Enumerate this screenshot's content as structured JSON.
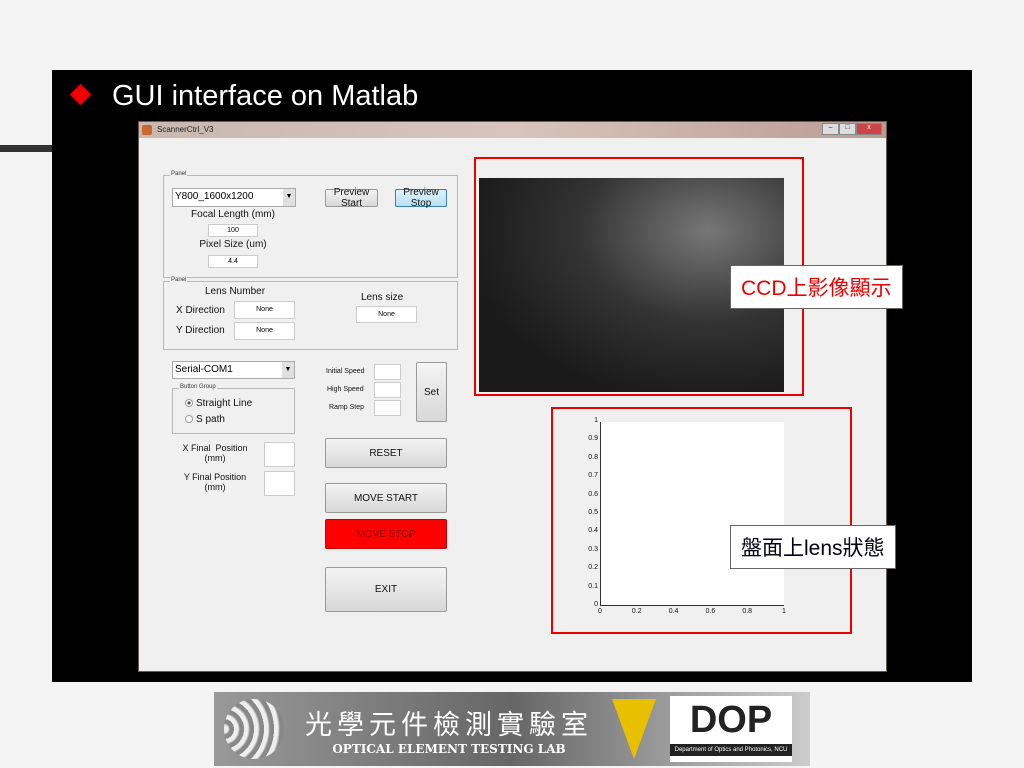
{
  "slide": {
    "title": "GUI interface on Matlab"
  },
  "window": {
    "title": "ScannerCtrl_V3",
    "min": "‒",
    "max": "□",
    "close": "x"
  },
  "panel1": {
    "title": "Panel",
    "camera_format": "Y800_1600x1200",
    "focal_label": "Focal Length (mm)",
    "focal_value": "100",
    "pixel_label": "Pixel Size (um)",
    "pixel_value": "4.4",
    "preview_start": "Preview Start",
    "preview_stop": "Preview Stop"
  },
  "panel2": {
    "title": "Panel",
    "lens_number": "Lens Number",
    "x_dir": "X Direction",
    "x_val": "None",
    "y_dir": "Y Direction",
    "y_val": "None",
    "lens_size": "Lens size",
    "lens_size_val": "None"
  },
  "serial": {
    "port": "Serial-COM1"
  },
  "button_group": {
    "title": "Button Group",
    "options": [
      "Straight Line",
      "S path"
    ],
    "selected": "Straight Line"
  },
  "positions": {
    "x_label": "X Final  Position\n(mm)",
    "y_label": "Y Final Position\n(mm)"
  },
  "speed": {
    "initial": "Initial  Speed",
    "high": "High  Speed",
    "ramp": "Ramp Step",
    "set": "Set"
  },
  "buttons": {
    "reset": "RESET",
    "move_start": "MOVE START",
    "move_stop": "MOVE STOP",
    "exit": "EXIT"
  },
  "colors": {
    "stop": "#ff0000",
    "highlight": "#e00000"
  },
  "callouts": {
    "ccd": "CCD上影像顯示",
    "lens": "盤面上lens狀態"
  },
  "axes": {
    "yticks": [
      "0",
      "0.1",
      "0.2",
      "0.3",
      "0.4",
      "0.5",
      "0.6",
      "0.7",
      "0.8",
      "0.9",
      "1"
    ],
    "xticks": [
      "0",
      "0.2",
      "0.4",
      "0.6",
      "0.8",
      "1"
    ]
  },
  "footer": {
    "lab_cn": "光學元件檢測實驗室",
    "lab_en": "OPTICAL ELEMENT TESTING LAB",
    "dept_logo": "DOP",
    "dept": "Department of Optics and Photonics, NCU"
  }
}
